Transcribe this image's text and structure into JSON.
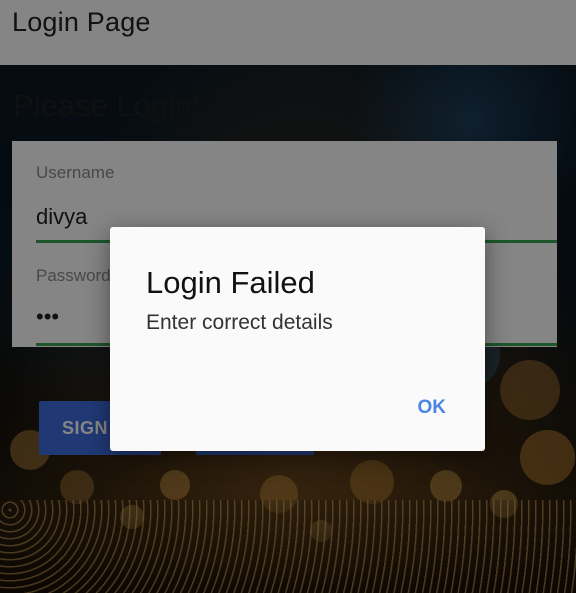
{
  "app_bar": {
    "title": "Login Page"
  },
  "page": {
    "heading": "Please Login!",
    "username": {
      "label": "Username",
      "value": "divya"
    },
    "password": {
      "label": "Password",
      "value": "•••"
    },
    "signin_button_label": "SIGN IN"
  },
  "dialog": {
    "title": "Login Failed",
    "message": "Enter correct details",
    "ok_label": "OK"
  },
  "colors": {
    "app_bar": "#ffffff",
    "field_underline": "#3aa655",
    "button": "#3f6ee0",
    "dialog_action": "#4a86e8"
  }
}
